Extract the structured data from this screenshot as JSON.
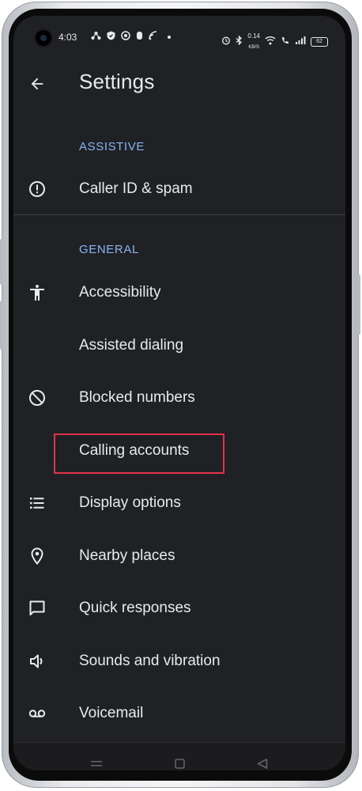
{
  "status_bar": {
    "time": "4:03",
    "net_speed_value": "0.14",
    "net_speed_unit": "KB/S",
    "battery": "62"
  },
  "header": {
    "title": "Settings",
    "back_icon": "arrow-back-icon"
  },
  "sections": {
    "assistive": {
      "label": "ASSISTIVE",
      "items": [
        {
          "label": "Caller ID & spam",
          "icon": "info-icon"
        }
      ]
    },
    "general": {
      "label": "GENERAL",
      "items": [
        {
          "label": "Accessibility",
          "icon": "accessibility-icon"
        },
        {
          "label": "Assisted dialing",
          "icon": ""
        },
        {
          "label": "Blocked numbers",
          "icon": "block-icon"
        },
        {
          "label": "Calling accounts",
          "icon": "",
          "highlighted": true
        },
        {
          "label": "Display options",
          "icon": "list-icon"
        },
        {
          "label": "Nearby places",
          "icon": "location-pin-icon"
        },
        {
          "label": "Quick responses",
          "icon": "chat-bubble-icon"
        },
        {
          "label": "Sounds and vibration",
          "icon": "speaker-icon"
        },
        {
          "label": "Voicemail",
          "icon": "voicemail-icon"
        }
      ]
    }
  },
  "colors": {
    "background": "#202124",
    "text": "#e8eaed",
    "section_header": "#8ab4f8",
    "highlight": "#e2334c"
  }
}
